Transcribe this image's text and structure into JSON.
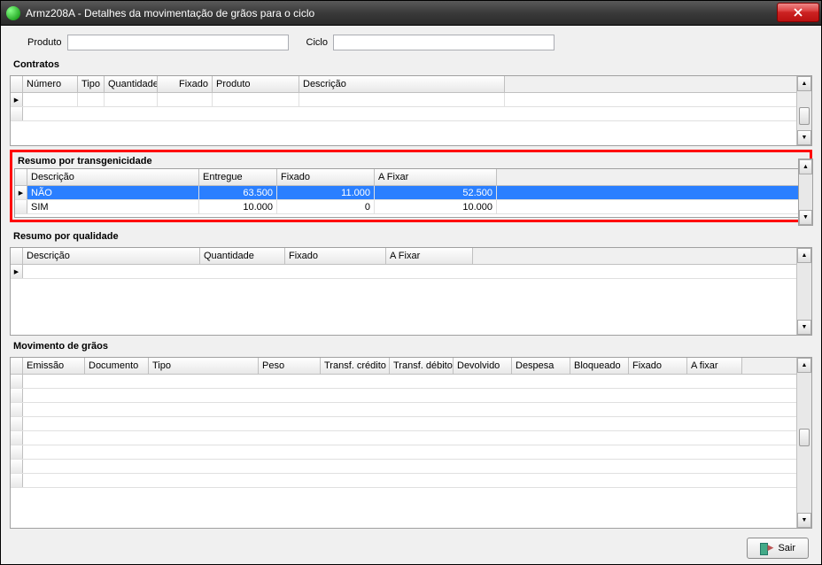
{
  "titlebar": {
    "text": "Armz208A - Detalhes da movimentação de grãos para o ciclo"
  },
  "top": {
    "produto_label": "Produto",
    "produto_value": "",
    "ciclo_label": "Ciclo",
    "ciclo_value": ""
  },
  "contratos": {
    "title": "Contratos",
    "headers": [
      "Número",
      "Tipo",
      "Quantidade",
      "Fixado",
      "Produto",
      "Descrição"
    ]
  },
  "resumo_transg": {
    "title": "Resumo por transgenicidade",
    "headers": [
      "Descrição",
      "Entregue",
      "Fixado",
      "A Fixar"
    ],
    "rows": [
      {
        "descricao": "NÃO",
        "entregue": "63.500",
        "fixado": "11.000",
        "a_fixar": "52.500",
        "selected": true
      },
      {
        "descricao": "SIM",
        "entregue": "10.000",
        "fixado": "0",
        "a_fixar": "10.000",
        "selected": false
      }
    ]
  },
  "resumo_qualidade": {
    "title": "Resumo por qualidade",
    "headers": [
      "Descrição",
      "Quantidade",
      "Fixado",
      "A Fixar"
    ]
  },
  "movimento": {
    "title": "Movimento de grãos",
    "headers": [
      "Emissão",
      "Documento",
      "Tipo",
      "Peso",
      "Transf. crédito",
      "Transf. débito",
      "Devolvido",
      "Despesa",
      "Bloqueado",
      "Fixado",
      "A fixar"
    ]
  },
  "exit_button": "Sair"
}
